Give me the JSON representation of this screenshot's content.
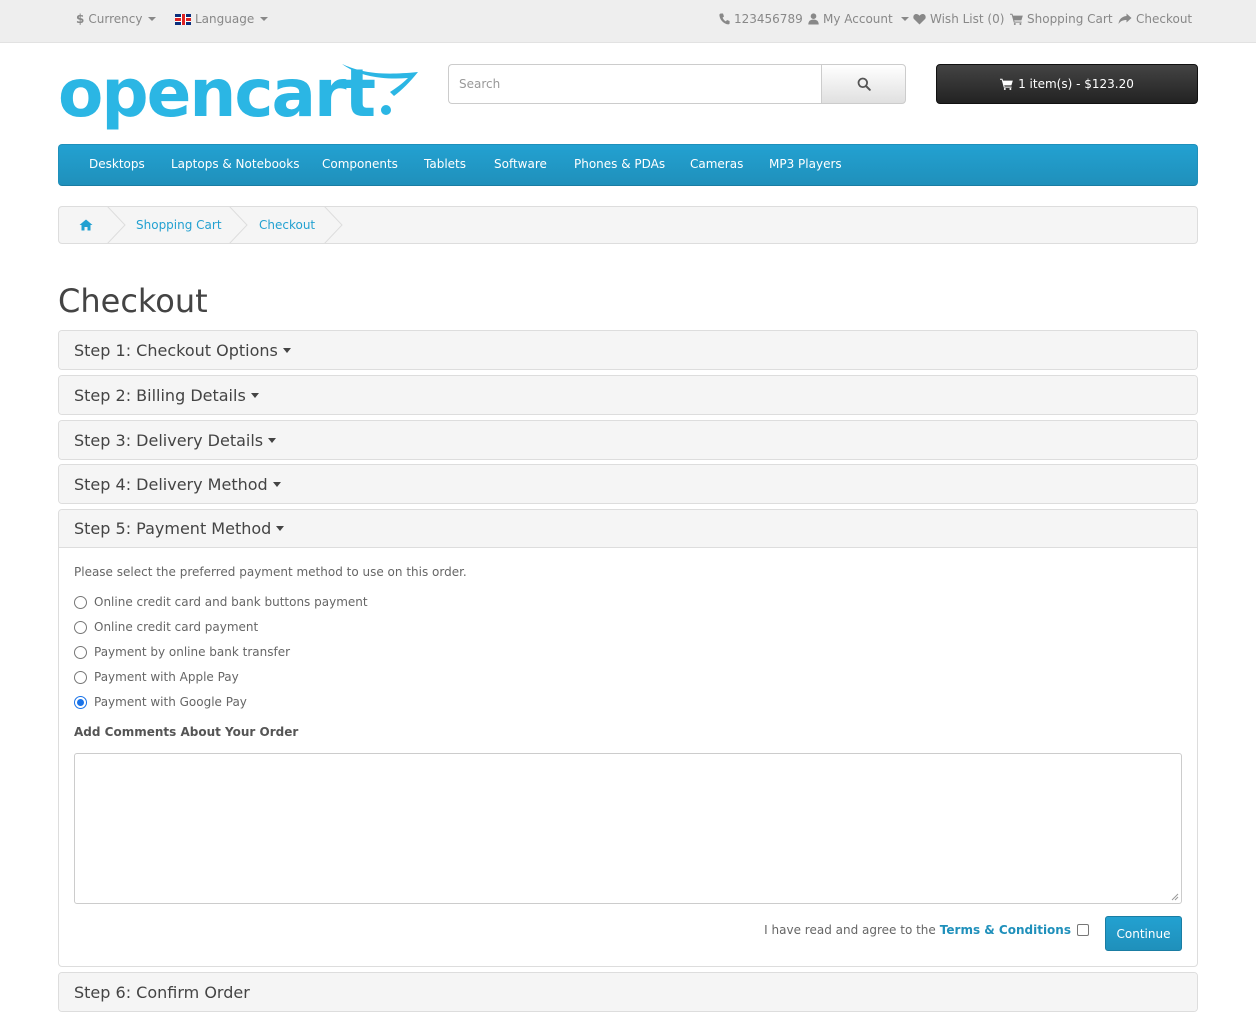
{
  "topbar": {
    "currency": "Currency",
    "currency_symbol": "$",
    "language": "Language",
    "phone": "123456789",
    "my_account": "My Account",
    "wishlist": "Wish List (0)",
    "shopping_cart": "Shopping Cart",
    "checkout": "Checkout"
  },
  "header": {
    "logo_text": "opencart",
    "search_placeholder": "Search",
    "cart_button": "1 item(s) - $123.20"
  },
  "menu": [
    "Desktops",
    "Laptops & Notebooks",
    "Components",
    "Tablets",
    "Software",
    "Phones & PDAs",
    "Cameras",
    "MP3 Players"
  ],
  "breadcrumb": [
    "Shopping Cart",
    "Checkout"
  ],
  "page_title": "Checkout",
  "steps": [
    "Step 1: Checkout Options",
    "Step 2: Billing Details",
    "Step 3: Delivery Details",
    "Step 4: Delivery Method",
    "Step 5: Payment Method",
    "Step 6: Confirm Order"
  ],
  "payment": {
    "intro": "Please select the preferred payment method to use on this order.",
    "options": [
      "Online credit card and bank buttons payment",
      "Online credit card payment",
      "Payment by online bank transfer",
      "Payment with Apple Pay",
      "Payment with Google Pay"
    ],
    "selected": "Payment with Google Pay",
    "comments_label": "Add Comments About Your Order",
    "comments_value": "",
    "agree_text": "I have read and agree to the",
    "terms_link": "Terms & Conditions",
    "continue_label": "Continue"
  },
  "colors": {
    "brand": "#23a1d1",
    "logo": "#2bb6e4",
    "radio_checked": "#1a73e8"
  }
}
